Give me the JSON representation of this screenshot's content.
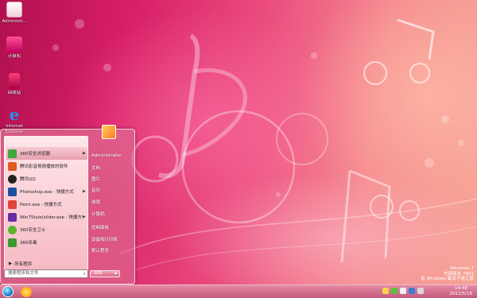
{
  "desktop": {
    "icons": [
      {
        "label": "Administr...",
        "icon": "user-folder-icon"
      },
      {
        "label": "计算机",
        "icon": "computer-icon"
      },
      {
        "label": "回收站",
        "icon": "recycle-bin-icon"
      },
      {
        "label": "Internet Explorer",
        "icon": "ie-icon"
      }
    ]
  },
  "start_menu": {
    "programs": [
      {
        "label": "360安全浏览器",
        "icon": "360-browser-icon",
        "color": "#3ea83a",
        "has_arrow": true
      },
      {
        "label": "腾讯影音视频播放的软件",
        "icon": "video-player-icon",
        "color": "#e05a1c",
        "has_arrow": false
      },
      {
        "label": "腾讯QQ",
        "icon": "qq-penguin-icon",
        "color": "#222222",
        "has_arrow": false
      },
      {
        "label": "Photoshop.exe - 快捷方式",
        "icon": "photoshop-icon",
        "color": "#1b4fa0",
        "has_arrow": true
      },
      {
        "label": "Paint.exe - 快捷方式",
        "icon": "paint-icon",
        "color": "#e0463a",
        "has_arrow": false
      },
      {
        "label": "Win7Style(slider.exe - 快捷方式",
        "icon": "slider-icon",
        "color": "#6a2ca0",
        "has_arrow": true
      },
      {
        "label": "360安全卫士",
        "icon": "360-safe-icon",
        "color": "#59b52b",
        "has_arrow": false
      },
      {
        "label": "360杀毒",
        "icon": "360-antivirus-icon",
        "color": "#3c9a2c",
        "has_arrow": false
      }
    ],
    "all_programs": "所有程序",
    "search_placeholder": "搜索程序和文件",
    "user_name": "Administrator",
    "links": [
      "文档",
      "图片",
      "音乐",
      "游戏",
      "计算机",
      "控制面板",
      "设备和打印机",
      "默认程序"
    ],
    "shutdown_label": "关机"
  },
  "taskbar": {
    "time": "14:49",
    "date": "2012/5/18"
  },
  "watermark": {
    "line1": "Windows 7",
    "line2": "内部版本 7601",
    "line3": "此 Windows 副本不是正版"
  },
  "colors": {
    "wallpaper_pink": "#d81f67",
    "wallpaper_peach": "#f6a494",
    "taskbar": "#c25a7c"
  }
}
